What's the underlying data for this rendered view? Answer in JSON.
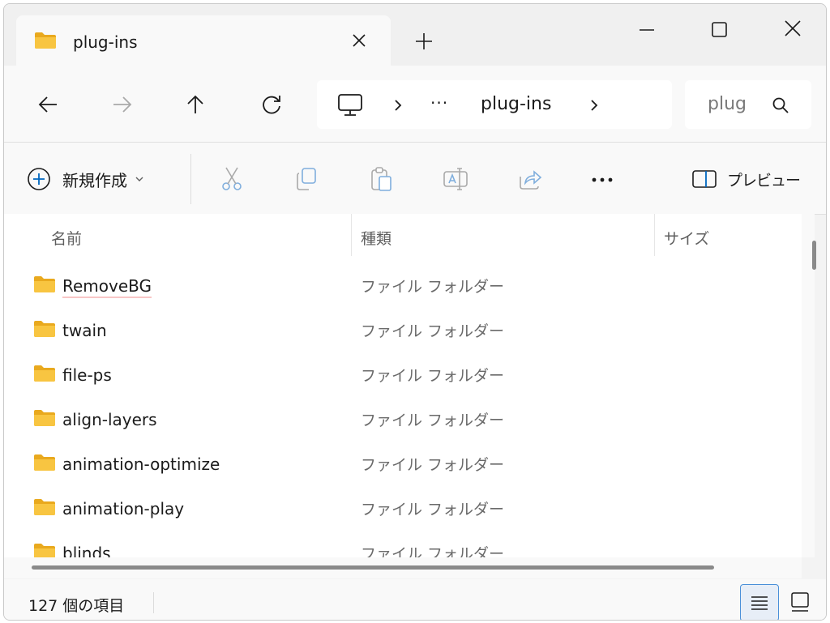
{
  "tab": {
    "title": "plug-ins"
  },
  "address": {
    "crumb": "plug-ins",
    "overflow": "···"
  },
  "search": {
    "value": "plug"
  },
  "commands": {
    "new_label": "新規作成",
    "preview_label": "プレビュー"
  },
  "columns": {
    "name": "名前",
    "type": "種類",
    "size": "サイズ"
  },
  "files": [
    {
      "name": "RemoveBG",
      "type": "ファイル フォルダー"
    },
    {
      "name": "twain",
      "type": "ファイル フォルダー"
    },
    {
      "name": "file-ps",
      "type": "ファイル フォルダー"
    },
    {
      "name": "align-layers",
      "type": "ファイル フォルダー"
    },
    {
      "name": "animation-optimize",
      "type": "ファイル フォルダー"
    },
    {
      "name": "animation-play",
      "type": "ファイル フォルダー"
    },
    {
      "name": "blinds",
      "type": "ファイル フォルダー"
    }
  ],
  "status": {
    "item_count": "127 個の項目"
  },
  "colors": {
    "folder": "#f8c541",
    "folder_dark": "#e9a91e",
    "accent": "#0067c0",
    "selected_view": "#4a90d9"
  }
}
